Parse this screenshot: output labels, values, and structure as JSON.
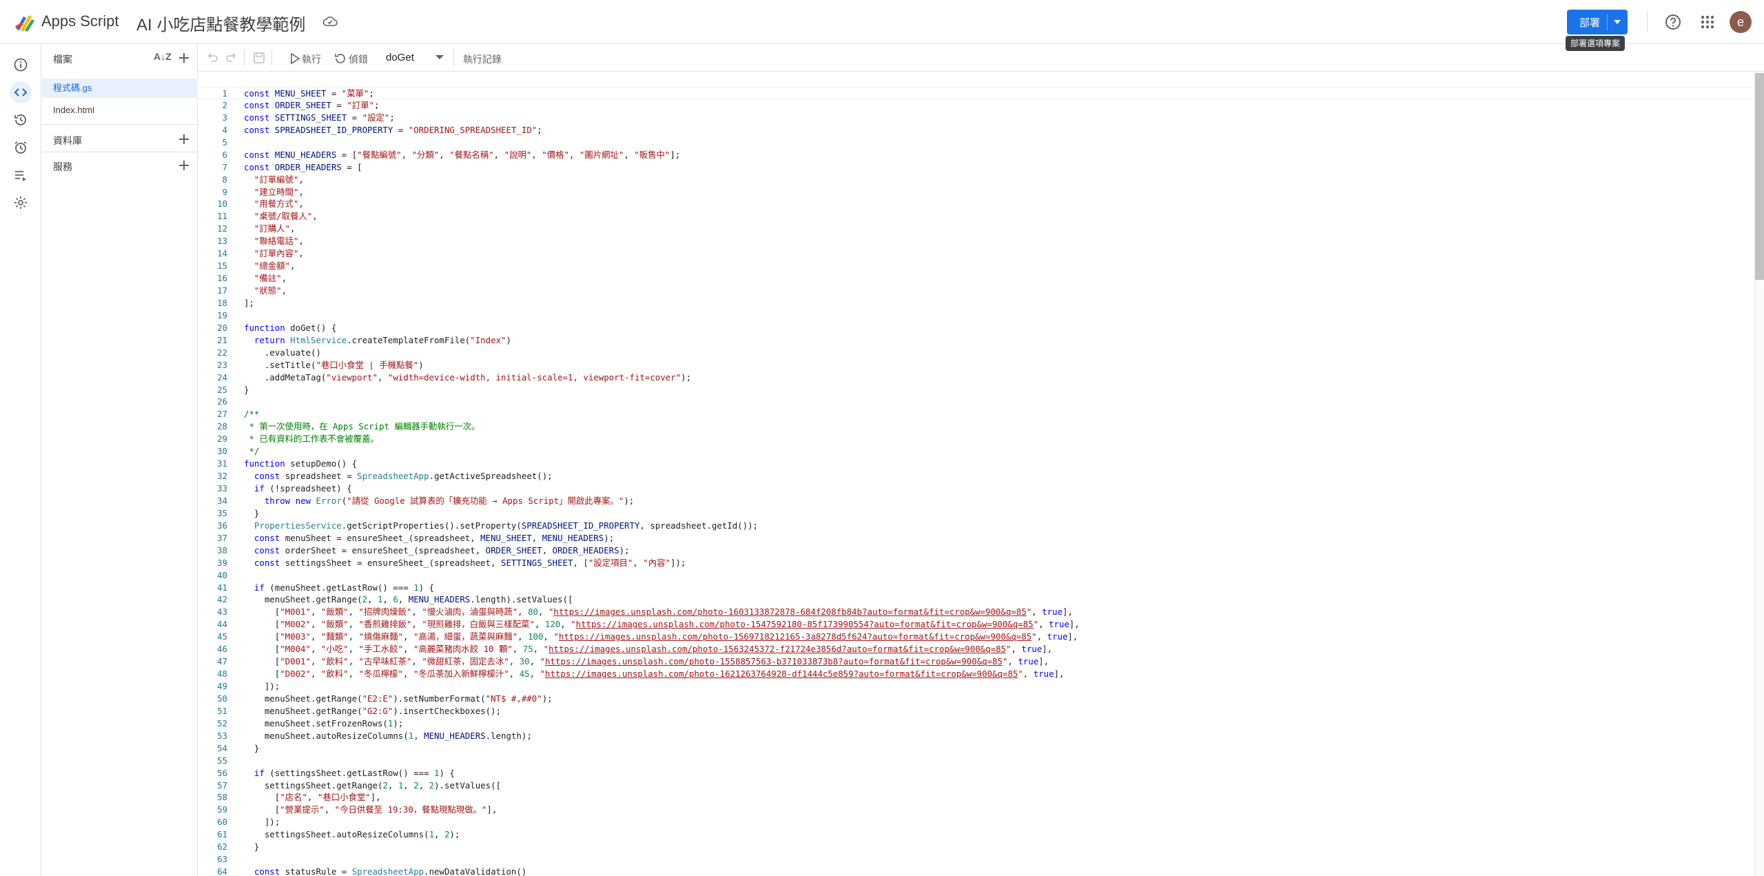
{
  "app": {
    "product_name": "Apps Script",
    "project_title": "AI 小吃店點餐教學範例",
    "deploy_label": "部署",
    "deploy_tooltip": "部署選項專案",
    "avatar_letter": "e"
  },
  "colors": {
    "accent": "#1a73e8",
    "active_bg": "#e8f0fe",
    "keyword": "#0000ff",
    "string": "#a31515",
    "number": "#098658",
    "comment": "#008000",
    "line_number": "#237893"
  },
  "rail": {
    "items": [
      {
        "icon": "info-icon"
      },
      {
        "icon": "code-icon",
        "active": true
      },
      {
        "icon": "history-icon"
      },
      {
        "icon": "alarm-trigger-icon"
      },
      {
        "icon": "executions-icon"
      },
      {
        "icon": "settings-icon"
      }
    ]
  },
  "files_panel": {
    "files_header": "檔案",
    "files": [
      "程式碼.gs",
      "Index.html"
    ],
    "libraries_header": "資料庫",
    "services_header": "服務"
  },
  "toolbar": {
    "run_label": "執行",
    "debug_label": "偵錯",
    "function_name": "doGet",
    "log_label": "執行記錄"
  },
  "editor": {
    "line_numbers": [
      "1",
      "2",
      "3",
      "4",
      "5",
      "6",
      "7",
      "8",
      "9",
      "10",
      "11",
      "12",
      "13",
      "14",
      "15",
      "16",
      "17",
      "18",
      "19",
      "20",
      "21",
      "22",
      "23",
      "24",
      "25",
      "26",
      "27",
      "28",
      "29",
      "30",
      "31",
      "32",
      "33",
      "34",
      "35",
      "36",
      "37",
      "38",
      "39",
      "40",
      "41",
      "42",
      "43",
      "44",
      "45",
      "46",
      "47",
      "48",
      "49",
      "50",
      "51",
      "52",
      "53",
      "54",
      "55",
      "56",
      "57",
      "58",
      "59",
      "60",
      "61",
      "62",
      "63",
      "64"
    ],
    "lines": [
      "const MENU_SHEET = \"菜單\";",
      "const ORDER_SHEET = \"訂單\";",
      "const SETTINGS_SHEET = \"設定\";",
      "const SPREADSHEET_ID_PROPERTY = \"ORDERING_SPREADSHEET_ID\";",
      "",
      "const MENU_HEADERS = [\"餐點編號\", \"分類\", \"餐點名稱\", \"說明\", \"價格\", \"圖片網址\", \"販售中\"];",
      "const ORDER_HEADERS = [",
      "  \"訂單編號\",",
      "  \"建立時間\",",
      "  \"用餐方式\",",
      "  \"桌號/取餐人\",",
      "  \"訂購人\",",
      "  \"聯絡電話\",",
      "  \"訂單內容\",",
      "  \"總金額\",",
      "  \"備註\",",
      "  \"狀態\",",
      "];",
      "",
      "function doGet() {",
      "  return HtmlService.createTemplateFromFile(\"Index\")",
      "    .evaluate()",
      "    .setTitle(\"巷口小食堂 | 手機點餐\")",
      "    .addMetaTag(\"viewport\", \"width=device-width, initial-scale=1, viewport-fit=cover\");",
      "}",
      "",
      "/**",
      " * 第一次使用時，在 Apps Script 編輯器手動執行一次。",
      " * 已有資料的工作表不會被覆蓋。",
      " */",
      "function setupDemo() {",
      "  const spreadsheet = SpreadsheetApp.getActiveSpreadsheet();",
      "  if (!spreadsheet) {",
      "    throw new Error(\"請從 Google 試算表的「擴充功能 → Apps Script」開啟此專案。\");",
      "  }",
      "  PropertiesService.getScriptProperties().setProperty(SPREADSHEET_ID_PROPERTY, spreadsheet.getId());",
      "  const menuSheet = ensureSheet_(spreadsheet, MENU_SHEET, MENU_HEADERS);",
      "  const orderSheet = ensureSheet_(spreadsheet, ORDER_SHEET, ORDER_HEADERS);",
      "  const settingsSheet = ensureSheet_(spreadsheet, SETTINGS_SHEET, [\"設定項目\", \"內容\"]);",
      "",
      "  if (menuSheet.getLastRow() === 1) {",
      "    menuSheet.getRange(2, 1, 6, MENU_HEADERS.length).setValues([",
      "      [\"M001\", \"飯類\", \"招牌肉燥飯\", \"慢火滷肉，滷蛋與時蔬\", 80, \"https://images.unsplash.com/photo-1603133872878-684f208fb84b?auto=format&fit=crop&w=900&q=85\", true],",
      "      [\"M002\", \"飯類\", \"香煎雞排飯\", \"現煎雞排，白飯與三樣配菜\", 120, \"https://images.unsplash.com/photo-1547592180-85f173990554?auto=format&fit=crop&w=900&q=85\", true],",
      "      [\"M003\", \"麵類\", \"燒傷麻麵\", \"高湯，細蛋，蔬菜與麻麵\", 100, \"https://images.unsplash.com/photo-1569718212165-3a8278d5f624?auto=format&fit=crop&w=900&q=85\", true],",
      "      [\"M004\", \"小吃\", \"手工水餃\", \"高麗菜豬肉水餃 10 顆\", 75, \"https://images.unsplash.com/photo-1563245372-f21724e3856d?auto=format&fit=crop&w=900&q=85\", true],",
      "      [\"D001\", \"飲料\", \"古早味紅茶\", \"微甜紅茶，固定去冰\", 30, \"https://images.unsplash.com/photo-1558857563-b371033873b8?auto=format&fit=crop&w=900&q=85\", true],",
      "      [\"D002\", \"飲料\", \"冬瓜檸檬\", \"冬瓜茶加入新鮮檸檬汁\", 45, \"https://images.unsplash.com/photo-1621263764928-df1444c5e859?auto=format&fit=crop&w=900&q=85\", true],",
      "    ]);",
      "    menuSheet.getRange(\"E2:E\").setNumberFormat(\"NT$ #,##0\");",
      "    menuSheet.getRange(\"G2:G\").insertCheckboxes();",
      "    menuSheet.setFrozenRows(1);",
      "    menuSheet.autoResizeColumns(1, MENU_HEADERS.length);",
      "  }",
      "",
      "  if (settingsSheet.getLastRow() === 1) {",
      "    settingsSheet.getRange(2, 1, 2, 2).setValues([",
      "      [\"店名\", \"巷口小食堂\"],",
      "      [\"營業提示\", \"今日供餐至 19:30，餐點現點現做。\"],",
      "    ]);",
      "    settingsSheet.autoResizeColumns(1, 2);",
      "  }",
      "",
      "  const statusRule = SpreadsheetApp.newDataValidation()"
    ]
  }
}
